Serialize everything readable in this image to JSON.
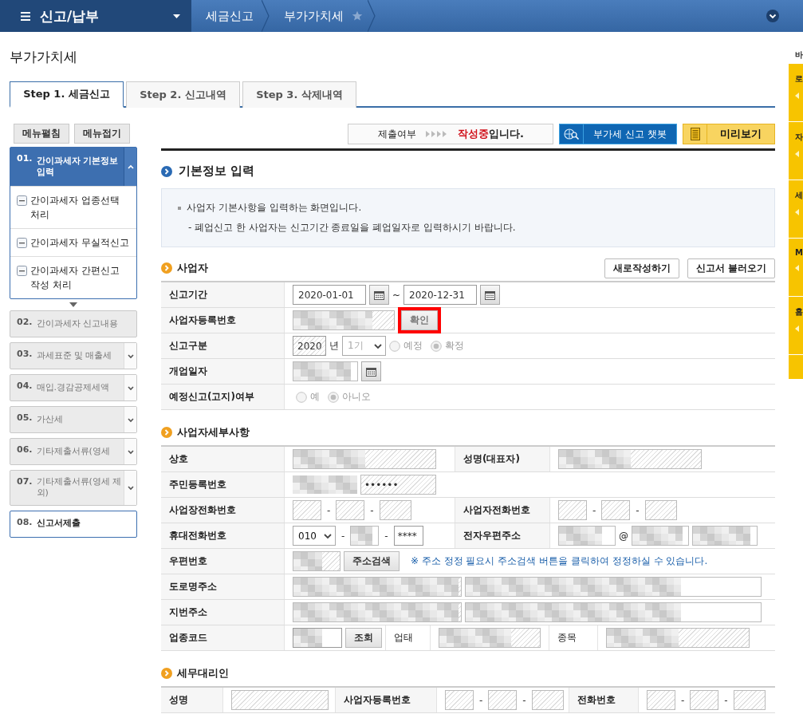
{
  "header": {
    "title": "신고/납부",
    "breadcrumbs": [
      "세금신고",
      "부가가치세"
    ]
  },
  "page_title": "부가가치세",
  "tabs": [
    {
      "label": "Step 1. 세금신고",
      "selected": true
    },
    {
      "label": "Step 2. 신고내역",
      "selected": false
    },
    {
      "label": "Step 3. 삭제내역",
      "selected": false
    }
  ],
  "sidebar": {
    "buttons": [
      "메뉴펼침",
      "메뉴접기"
    ],
    "steps": [
      {
        "number": "01.",
        "label": "간이과세자 기본정보 입력",
        "kind": "active",
        "expanded": true,
        "children": [
          {
            "label": "간이과세자 업종선택 처리"
          },
          {
            "label": "간이과세자 무실적신고"
          },
          {
            "label": "간이과세자 간편신고 작성 처리"
          }
        ]
      },
      {
        "number": "02.",
        "label": "간이과세자 신고내용",
        "kind": "locked",
        "expanded": false
      },
      {
        "number": "03.",
        "label": "과세표준 및 매출세",
        "kind": "folder",
        "expanded": false
      },
      {
        "number": "04.",
        "label": "매입.경감공제세액",
        "kind": "folder",
        "expanded": false
      },
      {
        "number": "05.",
        "label": "가산세",
        "kind": "folder",
        "expanded": false
      },
      {
        "number": "06.",
        "label": "기타제출서류(영세",
        "kind": "folder",
        "expanded": false
      },
      {
        "number": "07.",
        "label": "기타제출서류(영세 제외)",
        "kind": "folder",
        "expanded": false
      },
      {
        "number": "08.",
        "label": "신고서제출",
        "kind": "plain",
        "expanded": false
      }
    ]
  },
  "toolbar": {
    "status_label": "제출여부",
    "status": "작성중",
    "status_suffix": "입니다.",
    "buttons": [
      {
        "label": "부가세 신고 챗봇",
        "kind": "chatbot"
      },
      {
        "label": "미리보기",
        "kind": "preview"
      }
    ]
  },
  "section_title": "기본정보 입력",
  "notice": [
    "사업자 기본사항을 입력하는 화면입니다.",
    "- 폐업신고 한 사업자는 신고기간 종료일을 폐업일자로 입력하시기 바랍니다."
  ],
  "business": {
    "title": "사업자",
    "buttons": [
      "새로작성하기",
      "신고서 불러오기"
    ],
    "rows": [
      {
        "cells": [
          {
            "kind": "label",
            "label": "신고기간"
          },
          {
            "kind": "date_range",
            "from": "2020-01-01",
            "separator": "~",
            "to": "2020-12-31"
          }
        ]
      },
      {
        "cells": [
          {
            "kind": "label",
            "label": "사업자등록번호"
          },
          {
            "kind": "confirm",
            "button": "확인",
            "highlighted": true
          }
        ]
      },
      {
        "cells": [
          {
            "kind": "label",
            "label": "신고구분"
          },
          {
            "kind": "report_type",
            "year": "2020",
            "unit": "년",
            "period": "1기",
            "disabled": true,
            "options": [
              {
                "label": "예정",
                "selected": false
              },
              {
                "label": "확정",
                "selected": true
              }
            ]
          }
        ]
      },
      {
        "cells": [
          {
            "kind": "label",
            "label": "개업일자"
          },
          {
            "kind": "masked_date"
          }
        ]
      },
      {
        "cells": [
          {
            "kind": "label",
            "label": "예정신고(고지)여부"
          },
          {
            "kind": "radios",
            "disabled": true,
            "options": [
              {
                "label": "예",
                "selected": false
              },
              {
                "label": "아니오",
                "selected": true
              }
            ]
          }
        ]
      }
    ]
  },
  "details": {
    "title": "사업자세부사항",
    "rows": [
      {
        "cells": [
          {
            "kind": "label",
            "label": "상호"
          },
          {
            "kind": "masked",
            "readonly": true
          },
          {
            "kind": "label",
            "label": "성명(대표자)"
          },
          {
            "kind": "masked",
            "readonly": true
          }
        ]
      },
      {
        "cells": [
          {
            "kind": "label",
            "label": "주민등록번호"
          },
          {
            "kind": "masked_dots",
            "value": "••••••"
          }
        ]
      },
      {
        "cells": [
          {
            "kind": "label",
            "label": "사업장전화번호"
          },
          {
            "kind": "split",
            "readonly": true,
            "separators": [
              "-",
              "-"
            ]
          },
          {
            "kind": "label",
            "label": "사업자전화번호"
          },
          {
            "kind": "split",
            "readonly": true,
            "separators": [
              "-",
              "-"
            ]
          }
        ]
      },
      {
        "cells": [
          {
            "kind": "label",
            "label": "휴대전화번호"
          },
          {
            "kind": "mobile",
            "prefix": "010",
            "separators": [
              "-",
              "-"
            ],
            "last": "****"
          },
          {
            "kind": "label",
            "label": "전자우편주소"
          },
          {
            "kind": "email",
            "at": "@"
          }
        ]
      },
      {
        "cells": [
          {
            "kind": "label",
            "label": "우편번호"
          },
          {
            "kind": "postal",
            "button": "주소검색",
            "note": "※ 주소 정정 필요시 주소검색 버튼을 클릭하여 정정하실 수 있습니다."
          }
        ]
      },
      {
        "cells": [
          {
            "kind": "label",
            "label": "도로명주소"
          },
          {
            "kind": "address"
          }
        ]
      },
      {
        "cells": [
          {
            "kind": "label",
            "label": "지번주소"
          },
          {
            "kind": "address"
          }
        ]
      },
      {
        "cells": [
          {
            "kind": "label",
            "label": "업종코드"
          },
          {
            "kind": "code",
            "button": "조회"
          },
          {
            "kind": "sublabel",
            "label": "업태"
          },
          {
            "kind": "masked",
            "readonly": true
          },
          {
            "kind": "sublabel",
            "label": "종목"
          },
          {
            "kind": "masked",
            "readonly": true
          }
        ]
      }
    ]
  },
  "agent": {
    "title": "세무대리인",
    "rows": [
      {
        "cells": [
          {
            "kind": "label",
            "label": "성명"
          },
          {
            "kind": "blank",
            "readonly": true
          },
          {
            "kind": "label",
            "label": "사업자등록번호"
          },
          {
            "kind": "split",
            "readonly": true,
            "separators": [
              "-",
              "-"
            ]
          },
          {
            "kind": "label",
            "label": "전화번호"
          },
          {
            "kind": "split",
            "readonly": true,
            "separators": [
              "-",
              "-"
            ]
          }
        ]
      }
    ]
  },
  "quick_panel": {
    "heading": "바",
    "tabs": [
      "로",
      "자",
      "세",
      "M",
      "홈"
    ]
  }
}
